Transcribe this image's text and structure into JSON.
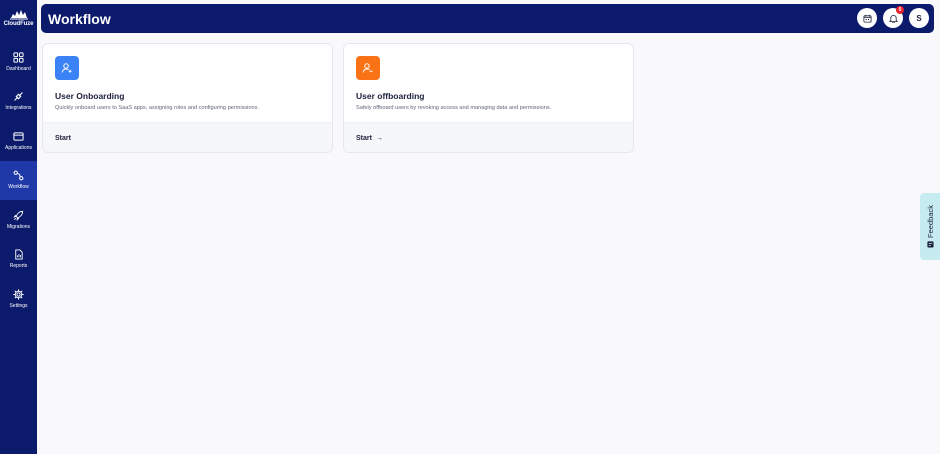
{
  "brand": {
    "name": "CloudFuze"
  },
  "sidebar": {
    "items": [
      {
        "label": "Dashboard",
        "icon": "dashboard-icon"
      },
      {
        "label": "Integrations",
        "icon": "plug-icon"
      },
      {
        "label": "Applications",
        "icon": "window-icon"
      },
      {
        "label": "Workflow",
        "icon": "workflow-icon",
        "active": true
      },
      {
        "label": "Migrations",
        "icon": "rocket-icon"
      },
      {
        "label": "Reports",
        "icon": "report-icon"
      },
      {
        "label": "Settings",
        "icon": "gear-icon"
      }
    ]
  },
  "header": {
    "title": "Workflow",
    "notifications_count": "0",
    "avatar_initial": "S"
  },
  "cards": [
    {
      "title": "User Onboarding",
      "description": "Quickly onboard users to SaaS apps, assigning roles and configuring permissions.",
      "action": "Start",
      "icon": "user-add-icon",
      "color": "#3b82f6"
    },
    {
      "title": "User offboarding",
      "description": "Safely offboard users by revoking access and managing data and permissions.",
      "action": "Start",
      "action_arrow": "→",
      "icon": "user-remove-icon",
      "color": "#f97316"
    }
  ],
  "feedback": {
    "label": "Feedback"
  }
}
